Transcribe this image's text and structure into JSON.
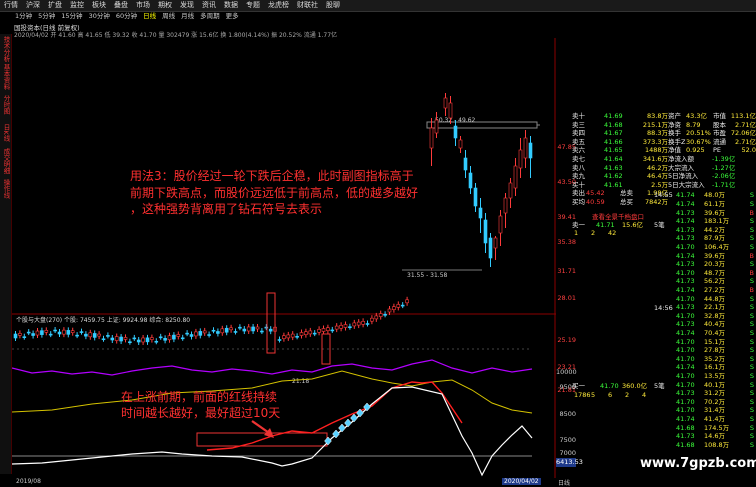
{
  "menu": [
    "行情",
    "沪深",
    "扩盘",
    "监控",
    "板块",
    "叠盘",
    "市场",
    "期权",
    "发现",
    "资讯",
    "数据",
    "专题",
    "龙虎榜",
    "财联社",
    "股聊"
  ],
  "periods": [
    "1分钟",
    "5分钟",
    "15分钟",
    "30分钟",
    "60分钟",
    "日线",
    "周线",
    "月线",
    "多周期",
    "更多"
  ],
  "active_period": "日线",
  "stock": {
    "title": "国投资本(日线 前复权)",
    "info": "2020/04/02 开 41.60 高 41.65 低 39.32 收 41.70 量 302479 涨 15.6亿 换 1.800(4.14%) 振 20.52% 流通 1.77亿"
  },
  "sidebar": [
    "技术分析",
    "基本资料",
    "分时图",
    "日K线",
    "成交明细",
    "操作线"
  ],
  "annotations": {
    "top": [
      "用法3：股价经过一轮下跌后企稳，此时副图指标高于",
      "前期下跌高点，而股价远远低于前高点，低的越多越好",
      "，这种强势背离用了钻石符号去表示"
    ],
    "bottom": [
      "在上涨前期，前面的红线持续",
      "时间越长越好，最好超过10天"
    ]
  },
  "main_chart": {
    "high_label": "50.32 - 49.62",
    "low_label": "31.55 - 31.58",
    "mid_label": "21.18",
    "price_ticks": [
      "47.85",
      "43.50",
      "39.41",
      "35.38",
      "31.71",
      "28.01",
      "25.19",
      "23.21",
      "21.81"
    ],
    "colors": {
      "up": "#ff3b3b",
      "down": "#3cf",
      "bg": "#000"
    }
  },
  "sub_chart": {
    "legend": "个股与大盘(270) 个股: 7459.75 上证: 9924.98 综合: 8250.80",
    "ticks": [
      "10000",
      "9500",
      "8500",
      "7500",
      "7000",
      "6413.53"
    ]
  },
  "date_axis": {
    "left": "2019/08",
    "right_tag": "2020/04/02",
    "right_end": "日线"
  },
  "right_panel": {
    "asks": [
      {
        "label": "卖十",
        "price": "41.69",
        "vol": "83.8万"
      },
      {
        "label": "卖三",
        "price": "41.68",
        "vol": "215.1万"
      },
      {
        "label": "卖四",
        "price": "41.67",
        "vol": "88.3万"
      },
      {
        "label": "卖五",
        "price": "41.66",
        "vol": "373.3万"
      },
      {
        "label": "卖六",
        "price": "41.65",
        "vol": "1488万"
      },
      {
        "label": "卖七",
        "price": "41.64",
        "vol": "341.6万"
      },
      {
        "label": "卖八",
        "price": "41.63",
        "vol": "46.2万"
      },
      {
        "label": "卖九",
        "price": "41.62",
        "vol": "46.4万"
      },
      {
        "label": "买十",
        "price": "41.61",
        "vol": "2.5万"
      }
    ],
    "summary": [
      {
        "label": "卖出",
        "a": "45.42",
        "b": "总卖",
        "c": "1.98亿"
      },
      {
        "label": "买均",
        "a": "40.59",
        "b": "总买",
        "c": "7842万"
      }
    ],
    "order_title": "查看全景千档盘口",
    "sell1": {
      "label": "卖一",
      "price": "41.71",
      "vol": "15.6亿",
      "n": "5笔"
    },
    "sell_nums": [
      "1",
      "2",
      "42"
    ],
    "buy1": {
      "label": "买一",
      "price": "41.70",
      "vol": "360.0亿",
      "n": "5笔"
    },
    "buy_nums": [
      "1786",
      "5",
      "6",
      "2",
      "4"
    ],
    "stats": [
      {
        "k": "资产",
        "v": "43.3亿",
        "k2": "市值",
        "v2": "113.1亿"
      },
      {
        "k": "净资",
        "v": "8.79",
        "k2": "股本",
        "v2": "2.71亿"
      },
      {
        "k": "换手",
        "v": "20.51%",
        "k2": "市盈",
        "v2": "72.06亿"
      },
      {
        "k": "换手Z",
        "v": "30.67%",
        "k2": "流通",
        "v2": "2.71亿"
      },
      {
        "k": "净值",
        "v": "0.925",
        "k2": "PE",
        "v2": "52.0"
      }
    ],
    "flows": [
      {
        "k": "净流入额",
        "v": "-1.39亿"
      },
      {
        "k": "大宗流入",
        "v": "-1.27亿"
      },
      {
        "k": "5日净流入",
        "v": "-2.06亿"
      },
      {
        "k": "5日大宗流入",
        "v": "-1.71亿"
      }
    ],
    "time_a": "14:55",
    "time_b": "14:56",
    "ticks_list": [
      {
        "p": "41.74",
        "v": "48.0万",
        "s": "S"
      },
      {
        "p": "41.74",
        "v": "61.1万",
        "s": "S"
      },
      {
        "p": "41.73",
        "v": "39.6万",
        "s": "B"
      },
      {
        "p": "41.74",
        "v": "183.1万",
        "s": "S"
      },
      {
        "p": "41.73",
        "v": "44.2万",
        "s": "S"
      },
      {
        "p": "41.73",
        "v": "87.9万",
        "s": "S"
      },
      {
        "p": "41.70",
        "v": "106.4万",
        "s": "S"
      },
      {
        "p": "41.74",
        "v": "39.6万",
        "s": "B"
      },
      {
        "p": "41.73",
        "v": "20.3万",
        "s": "S"
      },
      {
        "p": "41.70",
        "v": "48.7万",
        "s": "B"
      },
      {
        "p": "41.73",
        "v": "56.2万",
        "s": "S"
      },
      {
        "p": "41.74",
        "v": "27.2万",
        "s": "B"
      },
      {
        "p": "41.70",
        "v": "44.8万",
        "s": "S"
      },
      {
        "p": "41.73",
        "v": "22.1万",
        "s": "S"
      },
      {
        "p": "41.70",
        "v": "32.8万",
        "s": "S"
      },
      {
        "p": "41.73",
        "v": "40.4万",
        "s": "S"
      },
      {
        "p": "41.74",
        "v": "70.4万",
        "s": "S"
      },
      {
        "p": "41.70",
        "v": "15.1万",
        "s": "S"
      },
      {
        "p": "41.70",
        "v": "27.8万",
        "s": "S"
      },
      {
        "p": "41.70",
        "v": "35.2万",
        "s": "S"
      },
      {
        "p": "41.74",
        "v": "16.1万",
        "s": "S"
      },
      {
        "p": "41.70",
        "v": "13.5万",
        "s": "S"
      },
      {
        "p": "41.70",
        "v": "40.1万",
        "s": "S"
      },
      {
        "p": "41.73",
        "v": "31.2万",
        "s": "S"
      },
      {
        "p": "41.70",
        "v": "70.2万",
        "s": "S"
      },
      {
        "p": "41.70",
        "v": "31.4万",
        "s": "S"
      },
      {
        "p": "41.74",
        "v": "41.4万",
        "s": "S"
      },
      {
        "p": "41.68",
        "v": "174.5万",
        "s": "S"
      },
      {
        "p": "41.73",
        "v": "14.6万",
        "s": "S"
      },
      {
        "p": "41.68",
        "v": "108.8万",
        "s": "S"
      }
    ]
  },
  "watermark": "www.7gpzb.com"
}
